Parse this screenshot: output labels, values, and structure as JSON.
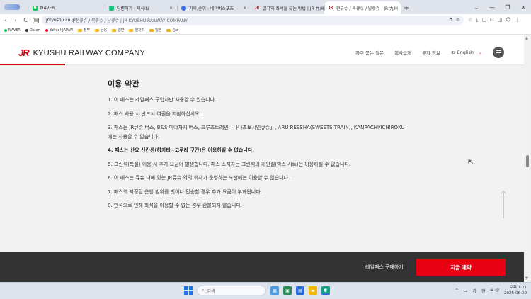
{
  "browser": {
    "tabs": [
      {
        "label": "",
        "fav_color": "#7a9bd8",
        "active": false
      },
      {
        "label": "NAVER",
        "fav_color": "#03c75a",
        "fav_char": "N",
        "active": false
      },
      {
        "label": "답변하기 : 지식iN",
        "fav_color": "#19c37d",
        "active": false
      },
      {
        "label": "기록,순위 : 네이버스포츠",
        "fav_color": "#3b6fe0",
        "active": false
      },
      {
        "label": "열차와 좌석을 찾는 방법 | JR 九州",
        "fav_color": "#d7000f",
        "fav_char": "JR",
        "active": false
      },
      {
        "label": "전규슈 / 북큐슈 / 남큐슈 | JR 九州",
        "fav_color": "#d7000f",
        "fav_char": "JR",
        "active": true
      }
    ],
    "new_tab": "+",
    "window_controls": {
      "dropdown": "⌄",
      "minimize": "—",
      "restore": "❐",
      "close": "✕"
    },
    "nav": {
      "back": "‹",
      "forward": "›",
      "reload": "C"
    },
    "address": {
      "domain": "jrkyushu.co.jp",
      "rest": " 전큐슈 / 북큐슈 / 남큐슈 | JR KYUSHU RAILWAY COMPANY"
    },
    "bookmarks": [
      {
        "label": "NAVER",
        "type": "dot",
        "color": "#03c75a"
      },
      {
        "label": "Daum",
        "type": "dot",
        "color": "#333333"
      },
      {
        "label": "Yahoo! JAPAN",
        "type": "dot",
        "color": "#ff0033"
      },
      {
        "label": "정부",
        "type": "folder"
      },
      {
        "label": "금융",
        "type": "folder"
      },
      {
        "label": "일반",
        "type": "folder"
      },
      {
        "label": "일자리",
        "type": "folder"
      },
      {
        "label": "일본",
        "type": "folder"
      },
      {
        "label": "중국",
        "type": "folder"
      }
    ]
  },
  "site": {
    "brand_mark": "JR",
    "brand_name": "KYUSHU RAILWAY COMPANY",
    "nav": {
      "faq": "자주 묻는 질문",
      "company": "회사소개",
      "investor": "투자 정보",
      "language": "English"
    }
  },
  "terms": {
    "title": "이용 약관",
    "items": [
      "1. 이 패스는 레일패스 구입자만 사용할 수 있습니다.",
      "2. 패스 사용 시 반드시 여권을 지참하십시오.",
      "3. 패스는 JR큐슈 버스, B&S 미야자키 버스, 크루즈트레인「나나츠보시인큐슈」, ARU RESSHA(SWEETS TRAIN), KANPACHI/ICHIROKU에는 사용할 수 없습니다.",
      "4. 패스는 산요 신칸센(하카타~고쿠라 구간)은 이용하실 수 없습니다.",
      "5. 그린석(특실) 이용 시 추가 요금이 발생합니다. 패스 소지자는 그린석의 개인실(박스 시트)은 이용하실 수 없습니다.",
      "6. 이 패스는 큐슈 내에 있는 JR큐슈 외의 회사가 운영하는 노선에는 이용할 수 없습니다.",
      "7. 패스의 지정된 운행 범위를 벗어나 탑승할 경우 추가 요금이 부과됩니다.",
      "8. 만석으로 인해 좌석을 이용할 수 없는 경우 환불되지 않습니다."
    ]
  },
  "actionbar": {
    "buy_link": "레일패스 구매하기",
    "reserve_button": "지금 예약"
  },
  "taskbar": {
    "search_placeholder": "검색",
    "tray_ime1": "가",
    "tray_ime2": "한",
    "time": "오후 1:21",
    "date": "2025-08-20"
  },
  "colors": {
    "brand_red": "#d7000f",
    "reserve_red": "#e60012",
    "footer_bg": "#333333",
    "content_bg": "#f2f2f2"
  }
}
